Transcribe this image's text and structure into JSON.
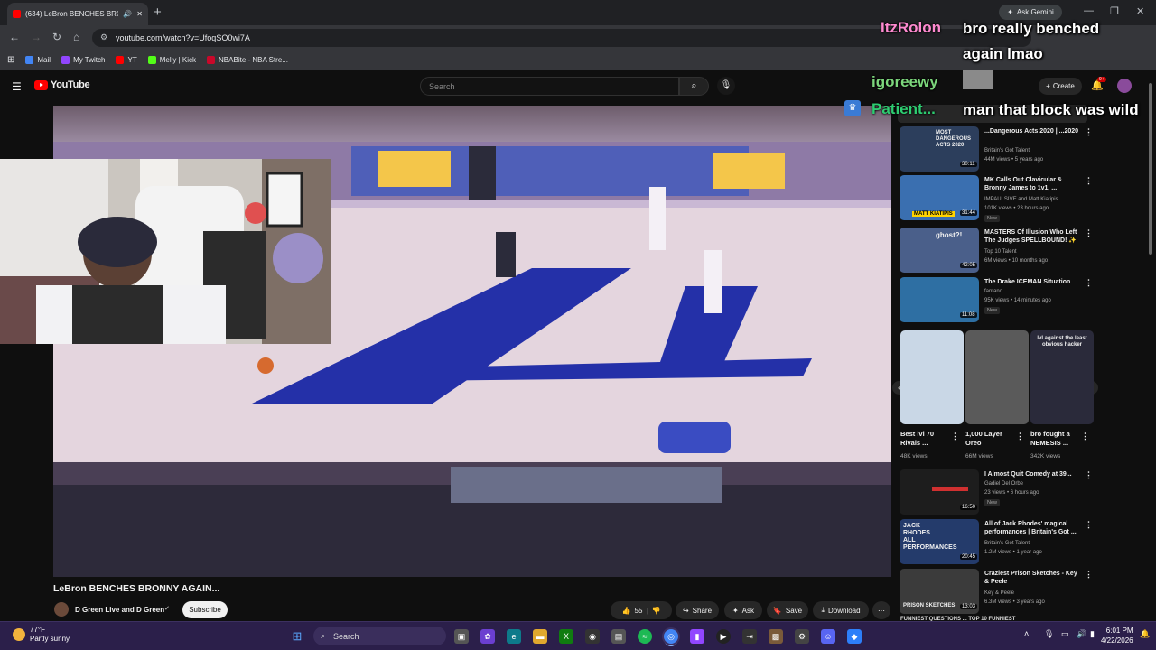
{
  "browser": {
    "tab_title": "(634) LeBron BENCHES BRO",
    "url": "youtube.com/watch?v=UfoqSO0wi7A",
    "ask_gemini": "Ask Gemini",
    "bookmarks": [
      {
        "label": "Mail",
        "color": "#4285f4"
      },
      {
        "label": "My Twitch",
        "color": "#9146ff"
      },
      {
        "label": "YT",
        "color": "#ff0000"
      },
      {
        "label": "Melly | Kick",
        "color": "#53fc18"
      },
      {
        "label": "NBABite - NBA Stre...",
        "color": "#c9082a"
      }
    ]
  },
  "youtube": {
    "logo_text": "YouTube",
    "search_placeholder": "Search",
    "create_label": "Create",
    "notif_badge": "9+"
  },
  "video": {
    "title": "LeBron BENCHES BRONNY AGAIN...",
    "channel": "D Green Live and D Green",
    "subscribe": "Subscribe",
    "likes": "55",
    "share": "Share",
    "ask": "Ask",
    "save": "Save",
    "download": "Download"
  },
  "sidebar": {
    "videos": [
      {
        "title": "...Dangerous Acts 2020 | ...2020",
        "channel": "Britain's Got Talent",
        "meta": "44M views • 5 years ago",
        "duration": "30:11",
        "new": "",
        "thumb": "#2c3e5c",
        "thumb_text": "MOST DANGEROUS ACTS 2020"
      },
      {
        "title": "MK Calls Out Clavicular & Bronny James to 1v1, ...",
        "channel": "IMPAULSIVE and Matt Kiatipis",
        "meta": "101K views • 23 hours ago",
        "duration": "31:44",
        "new": "New",
        "thumb": "#3a6fb0",
        "thumb_text": "MATT KIATIPIS"
      },
      {
        "title": "MASTERS Of Illusion Who Left The Judges SPELLBOUND! ✨",
        "channel": "Top 10 Talent",
        "meta": "6M views • 10 months ago",
        "duration": "42:05",
        "new": "",
        "thumb": "#4a5f8a",
        "thumb_text": "ghost?!"
      },
      {
        "title": "The Drake ICEMAN Situation",
        "channel": "fantano",
        "meta": "95K views • 14 minutes ago",
        "duration": "11:08",
        "new": "New",
        "thumb": "#2e6fa3",
        "thumb_text": ""
      },
      {
        "title": "I Almost Quit Comedy at 39...",
        "channel": "Gadiel Del Orbe",
        "meta": "23 views • 6 hours ago",
        "duration": "16:50",
        "new": "New",
        "thumb": "#1d1d1d",
        "thumb_text": ""
      },
      {
        "title": "All of Jack Rhodes' magical performances | Britain's Got ...",
        "channel": "Britain's Got Talent",
        "meta": "1.2M views • 1 year ago",
        "duration": "20:45",
        "new": "",
        "thumb": "#243b6b",
        "thumb_text": "JACK RHODES ALL PERFORMANCES"
      },
      {
        "title": "Craziest Prison Sketches - Key & Peele",
        "channel": "Key & Peele",
        "meta": "6.3M views • 3 years ago",
        "duration": "13:03",
        "new": "",
        "thumb": "#3b3b3b",
        "thumb_text": "PRISON SKETCHES"
      }
    ],
    "shorts": [
      {
        "title": "Best lvl 70 Rivals ...",
        "views": "48K views",
        "bg": "#c9d7e6",
        "text": ""
      },
      {
        "title": "1,000 Layer Oreo",
        "views": "66M views",
        "bg": "#5a5a5a",
        "text": ""
      },
      {
        "title": "bro fought a NEMESIS ...",
        "views": "342K views",
        "bg": "#2a2a3a",
        "text": "lvl against the least obvious hacker"
      }
    ],
    "bottom_cut": "FUNNIEST QUESTIONS ... TOP 10 FUNNIEST"
  },
  "chat": [
    {
      "name": "ItzRolon",
      "color": "#ff8ad0",
      "message": "bro really benched again lmao"
    },
    {
      "name": "igoreewy",
      "color": "#7cd67c",
      "message": ""
    },
    {
      "name": "Patient...",
      "color": "#2ecc71",
      "message": "man that block was wild"
    }
  ],
  "taskbar": {
    "temp": "77°F",
    "condition": "Partly sunny",
    "search": "Search",
    "time": "6:01 PM",
    "date": "4/22/2026"
  }
}
